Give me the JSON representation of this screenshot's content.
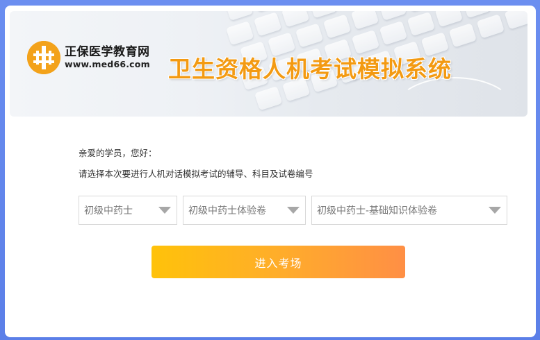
{
  "banner": {
    "logo_cn": "正保医学教育网",
    "logo_url": "www.med66.com",
    "title": "卫生资格人机考试模拟系统"
  },
  "form": {
    "greeting": "亲爱的学员，您好：",
    "instruction": "请选择本次要进行人机对话模拟考试的辅导、科目及试卷编号",
    "select_course": "初级中药士",
    "select_subject": "初级中药士体验卷",
    "select_paper": "初级中药士-基础知识体验卷",
    "enter_label": "进入考场"
  },
  "colors": {
    "accent_orange": "#f39a12",
    "button_start": "#ffc20a",
    "button_end": "#ff8f45",
    "background_blue": "#6b8ef0"
  },
  "icons": {
    "logo": "med66-logo-icon",
    "dropdown": "chevron-down-icon"
  }
}
